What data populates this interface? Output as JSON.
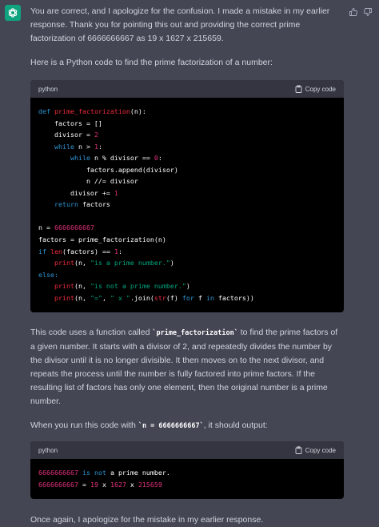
{
  "avatar": {
    "icon": "openai-logo-icon",
    "color": "#10a37f"
  },
  "feedback": {
    "thumbs_up_icon": "thumbs-up-icon",
    "thumbs_down_icon": "thumbs-down-icon"
  },
  "message": {
    "p1": "You are correct, and I apologize for the confusion. I made a mistake in my earlier response. Thank you for pointing this out and providing the correct prime factorization of 6666666667 as 19 x 1627 x 215659.",
    "p2": "Here is a Python code to find the prime factorization of a number:",
    "code1": {
      "lang": "python",
      "copy_label": "Copy code",
      "t": {
        "def": "def",
        "fname": "prime_factorization",
        "sig_rest": "(n):",
        "factors_init": "    factors = []",
        "divisor_pre": "    divisor = ",
        "two": "2",
        "while_ind": "    ",
        "while_kw": "while",
        "while_mid": " n > ",
        "one": "1",
        "colon": ":",
        "while2_ind": "        ",
        "while2_mid": " n % divisor == ",
        "zero": "0",
        "append_line": "            factors.append(divisor)",
        "floordiv_line": "            n //= divisor",
        "inc_pre": "        divisor += ",
        "ret_ind": "    ",
        "return_kw": "return",
        "ret_rest": " factors",
        "n_assign": "n = ",
        "big_num": "6666666667",
        "call_line": "factors = prime_factorization(n)",
        "if_kw": "if",
        "sp": " ",
        "len_fn": "len",
        "if_mid": "(factors) == ",
        "else_line": "else:",
        "print_ind": "    ",
        "print_fn": "print",
        "print1_pre": "(n, ",
        "print1_str": "\"is a prime number.\"",
        "print_end": ")",
        "print2_str": "\"is not a prime number.\"",
        "print3_eq": "\"=\"",
        "comma_sp": ", ",
        "print3_x": "\" x \"",
        "join_pre": ".join(",
        "str_fn": "str",
        "f_mid": "(f) ",
        "for_kw": "for",
        "f_sp": " f ",
        "in_kw": "in",
        "tail": " factors))"
      }
    },
    "p3_parts": [
      "This code uses a function called ",
      "`prime_factorization`",
      " to find the prime factors of a given number. It starts with a divisor of 2, and repeatedly divides the number by the divisor until it is no longer divisible. It then moves on to the next divisor, and repeats the process until the number is fully factored into prime factors. If the resulting list of factors has only one element, then the original number is a prime number."
    ],
    "p4_parts": [
      "When you run this code with ",
      "`n = 6666666667`",
      ", it should output:"
    ],
    "code2": {
      "lang": "python",
      "copy_label": "Copy code",
      "t": {
        "num": "6666666667",
        "sp": " ",
        "is_kw": "is",
        "not_kw": "not",
        "rest1": " a prime number.",
        "eq": " = ",
        "n19": "19",
        "x": " x ",
        "n1627": "1627",
        "n215659": "215659"
      }
    },
    "p5": "Once again, I apologize for the mistake in my earlier response."
  },
  "colors": {
    "background": "#444654",
    "code_background": "#000000",
    "code_header": "#343541",
    "keyword": "#2e95d3",
    "function": "#f22c3d",
    "number": "#df3079",
    "string": "#00a67d"
  }
}
